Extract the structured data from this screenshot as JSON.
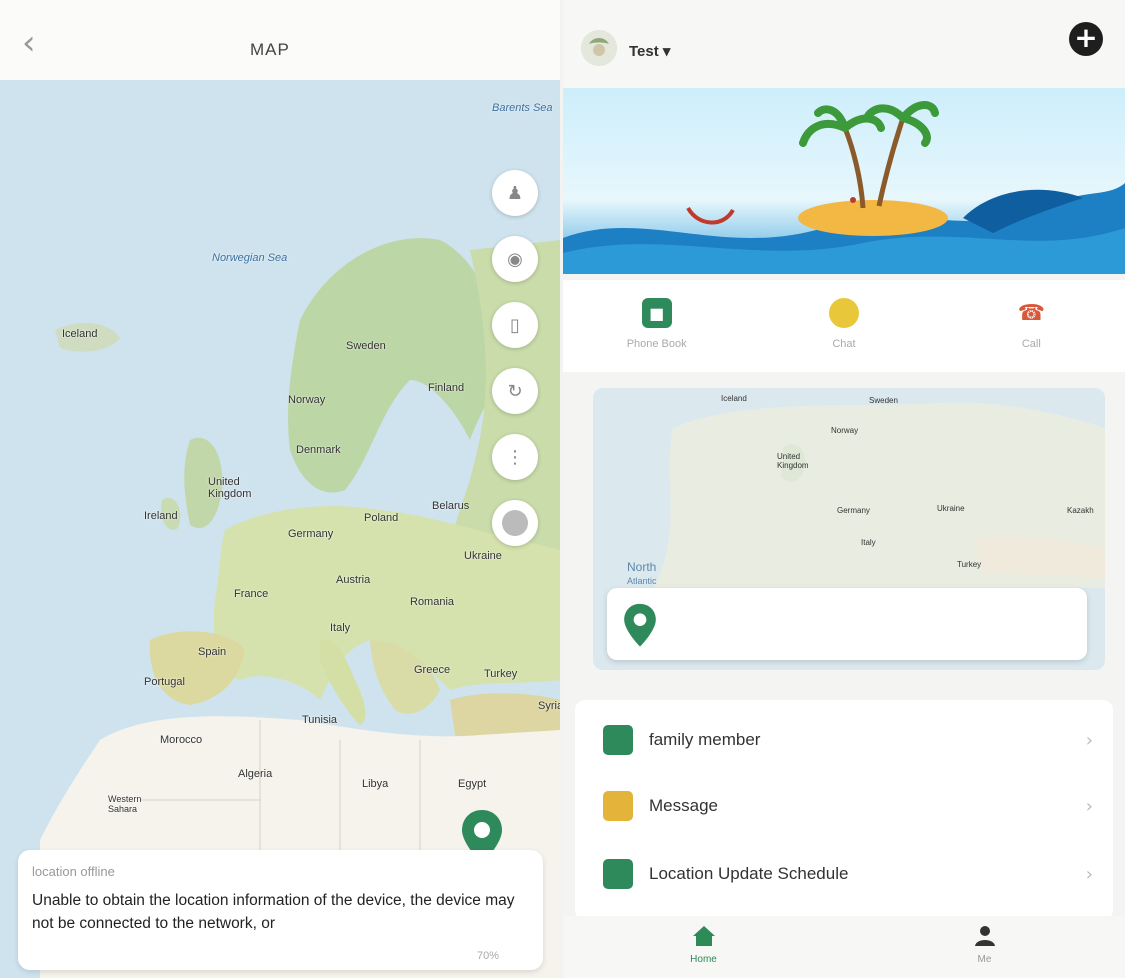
{
  "map_screen": {
    "back_icon": "chevron-left-icon",
    "title": "MAP",
    "map_labels": {
      "barents_sea": "Barents Sea",
      "norwegian_sea": "Norwegian Sea",
      "iceland": "Iceland",
      "sweden": "Sweden",
      "finland": "Finland",
      "norway": "Norway",
      "denmark": "Denmark",
      "united_kingdom": "United Kingdom",
      "ireland": "Ireland",
      "belarus": "Belarus",
      "germany": "Germany",
      "poland": "Poland",
      "ukraine": "Ukraine",
      "france": "France",
      "austria": "Austria",
      "romania": "Romania",
      "italy": "Italy",
      "spain": "Spain",
      "portugal": "Portugal",
      "greece": "Greece",
      "turkey": "Turkey",
      "syria": "Syria",
      "tunisia": "Tunisia",
      "morocco": "Morocco",
      "algeria": "Algeria",
      "libya": "Libya",
      "egypt": "Egypt",
      "western_sahara": "Western Sahara"
    },
    "tools": [
      "person-icon",
      "location-icon",
      "phone-icon",
      "history-icon",
      "footprint-icon",
      "satellite-icon"
    ],
    "location_card": {
      "title": "location offline",
      "message": "Unable to obtain the location information of the device, the device may not be connected to the network, or",
      "time": "70%"
    }
  },
  "home_screen": {
    "device_name": "Test",
    "add_icon": "plus-circle-icon",
    "quick_actions": [
      {
        "label": "Phone Book",
        "icon": "phonebook-icon",
        "color": "#2f8a5b"
      },
      {
        "label": "Chat",
        "icon": "chat-icon",
        "color": "#e8c83a"
      },
      {
        "label": "Call",
        "icon": "call-icon",
        "color": "#d9573a"
      }
    ],
    "mini_map_labels": {
      "iceland": "Iceland",
      "sweden": "Sweden",
      "norway": "Norway",
      "united_kingdom": "United Kingdom",
      "germany": "Germany",
      "ukraine": "Ukraine",
      "italy": "Italy",
      "turkey": "Turkey",
      "kazakhstan": "Kazakh",
      "north_atlantic": "North",
      "north_atlantic_2": "Atlantic"
    },
    "menu": [
      {
        "label": "family member",
        "icon": "family-icon",
        "color": "#2f8a5b"
      },
      {
        "label": "Message",
        "icon": "message-icon",
        "color": "#e4b43a"
      },
      {
        "label": "Location Update Schedule",
        "icon": "schedule-icon",
        "color": "#2f8a5b"
      }
    ],
    "tabs": [
      {
        "label": "Home",
        "icon": "home-icon"
      },
      {
        "label": "Me",
        "icon": "person-icon"
      }
    ]
  }
}
